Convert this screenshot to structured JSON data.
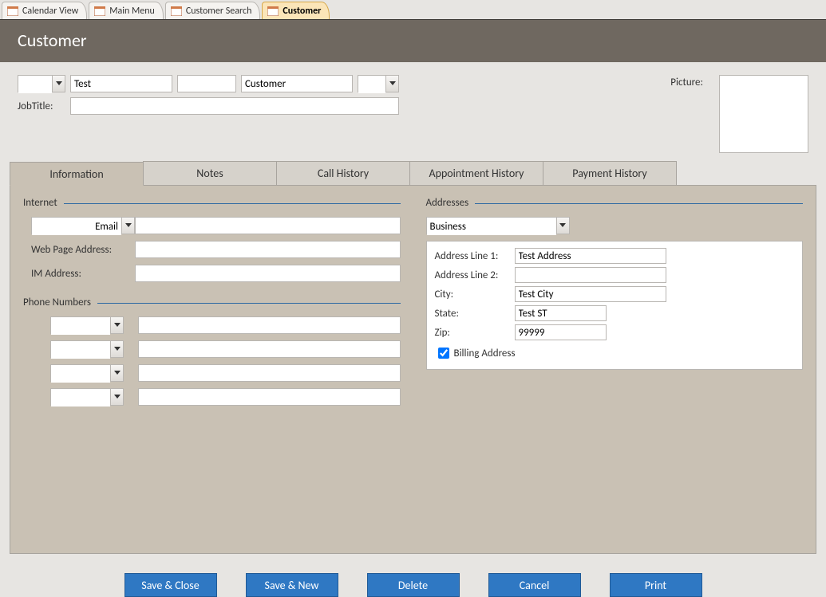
{
  "doc_tabs": [
    {
      "label": "Calendar View",
      "active": false
    },
    {
      "label": "Main Menu",
      "active": false
    },
    {
      "label": "Customer Search",
      "active": false
    },
    {
      "label": "Customer",
      "active": true
    }
  ],
  "header": {
    "title": "Customer"
  },
  "name_section": {
    "prefix": "",
    "first_name": "Test",
    "middle_name": "",
    "last_name": "Customer",
    "suffix": "",
    "job_title_label": "JobTitle:",
    "job_title": ""
  },
  "picture": {
    "label": "Picture:"
  },
  "detail_tabs": [
    {
      "label": "Information",
      "active": true
    },
    {
      "label": "Notes",
      "active": false
    },
    {
      "label": "Call History",
      "active": false
    },
    {
      "label": "Appointment History",
      "active": false
    },
    {
      "label": "Payment History",
      "active": false
    }
  ],
  "internet_group": {
    "title": "Internet",
    "email_type_label": "Email",
    "email_value": "",
    "web_label": "Web Page Address:",
    "web_value": "",
    "im_label": "IM Address:",
    "im_value": ""
  },
  "phone_group": {
    "title": "Phone Numbers",
    "rows": [
      {
        "type": "",
        "number": ""
      },
      {
        "type": "",
        "number": ""
      },
      {
        "type": "",
        "number": ""
      },
      {
        "type": "",
        "number": ""
      }
    ]
  },
  "addresses_group": {
    "title": "Addresses",
    "type": "Business",
    "line1_label": "Address Line 1:",
    "line1": "Test Address",
    "line2_label": "Address Line 2:",
    "line2": "",
    "city_label": "City:",
    "city": "Test City",
    "state_label": "State:",
    "state": "Test ST",
    "zip_label": "Zip:",
    "zip": "99999",
    "billing_label": "Billing Address",
    "billing_checked": true
  },
  "buttons": {
    "save_close": "Save & Close",
    "save_new": "Save & New",
    "delete": "Delete",
    "cancel": "Cancel",
    "print": "Print"
  }
}
